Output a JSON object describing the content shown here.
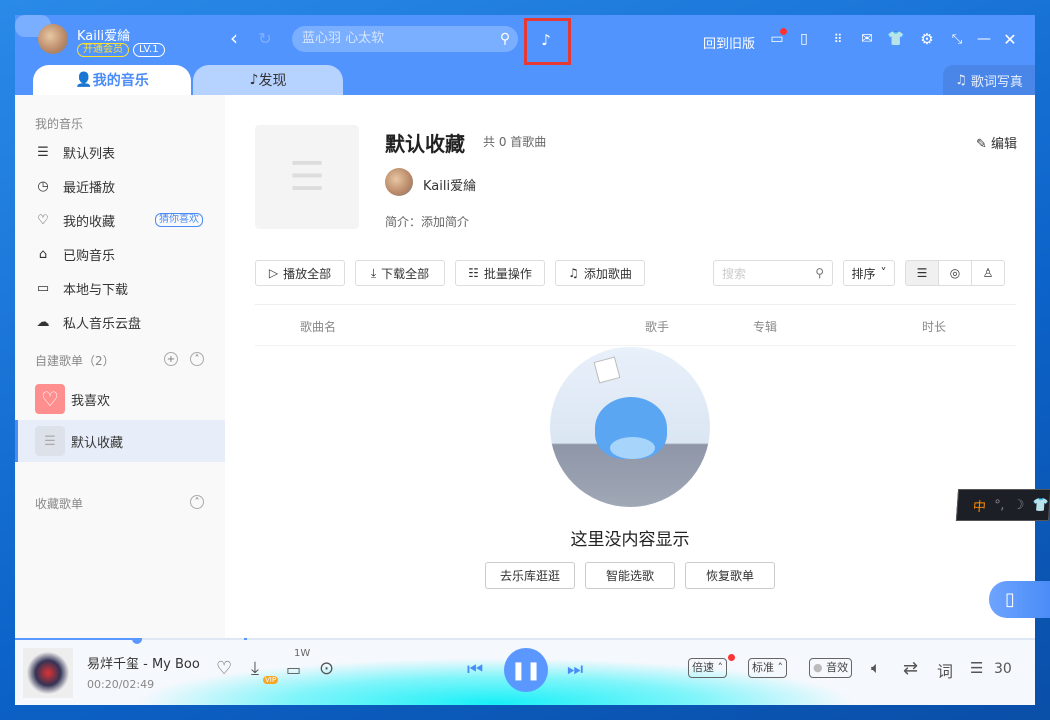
{
  "user": {
    "name": "Kaili爱綸",
    "vip_label": "开通会员",
    "level": "LV.1"
  },
  "search": {
    "placeholder": "蓝心羽 心太软"
  },
  "header": {
    "old_version": "回到旧版",
    "lyrics_photo": "歌词写真"
  },
  "tabs": [
    {
      "label": "我的音乐"
    },
    {
      "label": "发现"
    }
  ],
  "sidebar": {
    "my_music_header": "我的音乐",
    "items": [
      {
        "label": "默认列表"
      },
      {
        "label": "最近播放"
      },
      {
        "label": "我的收藏",
        "badge": "猜你喜欢"
      },
      {
        "label": "已购音乐"
      },
      {
        "label": "本地与下载"
      },
      {
        "label": "私人音乐云盘"
      }
    ],
    "created_header": "自建歌单（2）",
    "playlists": [
      {
        "label": "我喜欢"
      },
      {
        "label": "默认收藏"
      }
    ],
    "collected_header": "收藏歌单"
  },
  "playlist": {
    "title": "默认收藏",
    "count": "共 0 首歌曲",
    "owner": "Kaili爱綸",
    "intro": "简介：添加简介",
    "edit": "编辑"
  },
  "toolbar": {
    "play_all": "播放全部",
    "download_all": "下载全部",
    "batch": "批量操作",
    "add_song": "添加歌曲",
    "search_placeholder": "搜索",
    "sort": "排序"
  },
  "columns": {
    "name": "歌曲名",
    "artist": "歌手",
    "album": "专辑",
    "duration": "时长"
  },
  "empty": {
    "text": "这里没内容显示",
    "buttons": [
      "去乐库逛逛",
      "智能选歌",
      "恢复歌单"
    ]
  },
  "player": {
    "song": "易烊千玺 - My Boo",
    "time": "00:20/02:49",
    "comments": "1W",
    "progress": 0.12,
    "speed": "倍速",
    "quality": "标准",
    "effect": "音效",
    "lyric": "词",
    "queue_count": "30",
    "vip_tag": "VIP"
  },
  "ime": {
    "mode": "中"
  },
  "colors": {
    "accent": "#5294fe",
    "selected": "#e8eef9"
  }
}
